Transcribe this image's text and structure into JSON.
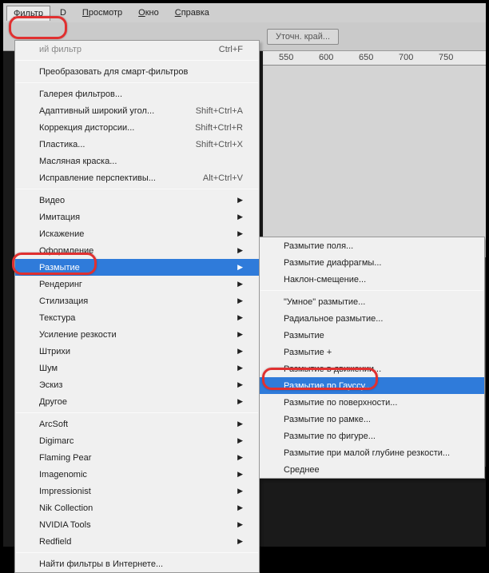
{
  "menubar": {
    "filter": "Фильтр",
    "threed": "D",
    "view": "Просмотр",
    "window": "Окно",
    "help": "Справка"
  },
  "toolbar": {
    "refine_edge": "Уточн. край..."
  },
  "ruler": {
    "t550": "550",
    "t600": "600",
    "t650": "650",
    "t700": "700",
    "t750": "750"
  },
  "menu": {
    "last_filter": "ий фильтр",
    "last_filter_sc": "Ctrl+F",
    "convert_smart": "Преобразовать для смарт-фильтров",
    "filter_gallery": "Галерея фильтров...",
    "adaptive_wide": "Адаптивный широкий угол...",
    "adaptive_wide_sc": "Shift+Ctrl+A",
    "lens_correction": "Коррекция дисторсии...",
    "lens_correction_sc": "Shift+Ctrl+R",
    "liquify": "Пластика...",
    "liquify_sc": "Shift+Ctrl+X",
    "oil_paint": "Масляная краска...",
    "vanishing": "Исправление перспективы...",
    "vanishing_sc": "Alt+Ctrl+V",
    "video": "Видео",
    "artistic": "Имитация",
    "distort": "Искажение",
    "pixelate": "Оформление",
    "blur": "Размытие",
    "render": "Рендеринг",
    "stylize": "Стилизация",
    "texture": "Текстура",
    "sharpen": "Усиление резкости",
    "strokes": "Штрихи",
    "noise": "Шум",
    "sketch": "Эскиз",
    "other": "Другое",
    "arcsoft": "ArcSoft",
    "digimarc": "Digimarc",
    "flamingpear": "Flaming Pear",
    "imagenomic": "Imagenomic",
    "impressionist": "Impressionist",
    "nikcollection": "Nik Collection",
    "nvidia": "NVIDIA Tools",
    "redfield": "Redfield",
    "browse": "Найти фильтры в Интернете..."
  },
  "submenu": {
    "field": "Размытие поля...",
    "iris": "Размытие диафрагмы...",
    "tiltshift": "Наклон-смещение...",
    "smart": "\"Умное\" размытие...",
    "radial": "Радиальное размытие...",
    "blur": "Размытие",
    "blurmore": "Размытие +",
    "motion": "Размытие в движении...",
    "gaussian": "Размытие по Гауссу...",
    "surface": "Размытие по поверхности...",
    "box": "Размытие по рамке...",
    "shape": "Размытие по фигуре...",
    "lens": "Размытие при малой глубине резкости...",
    "average": "Среднее"
  }
}
